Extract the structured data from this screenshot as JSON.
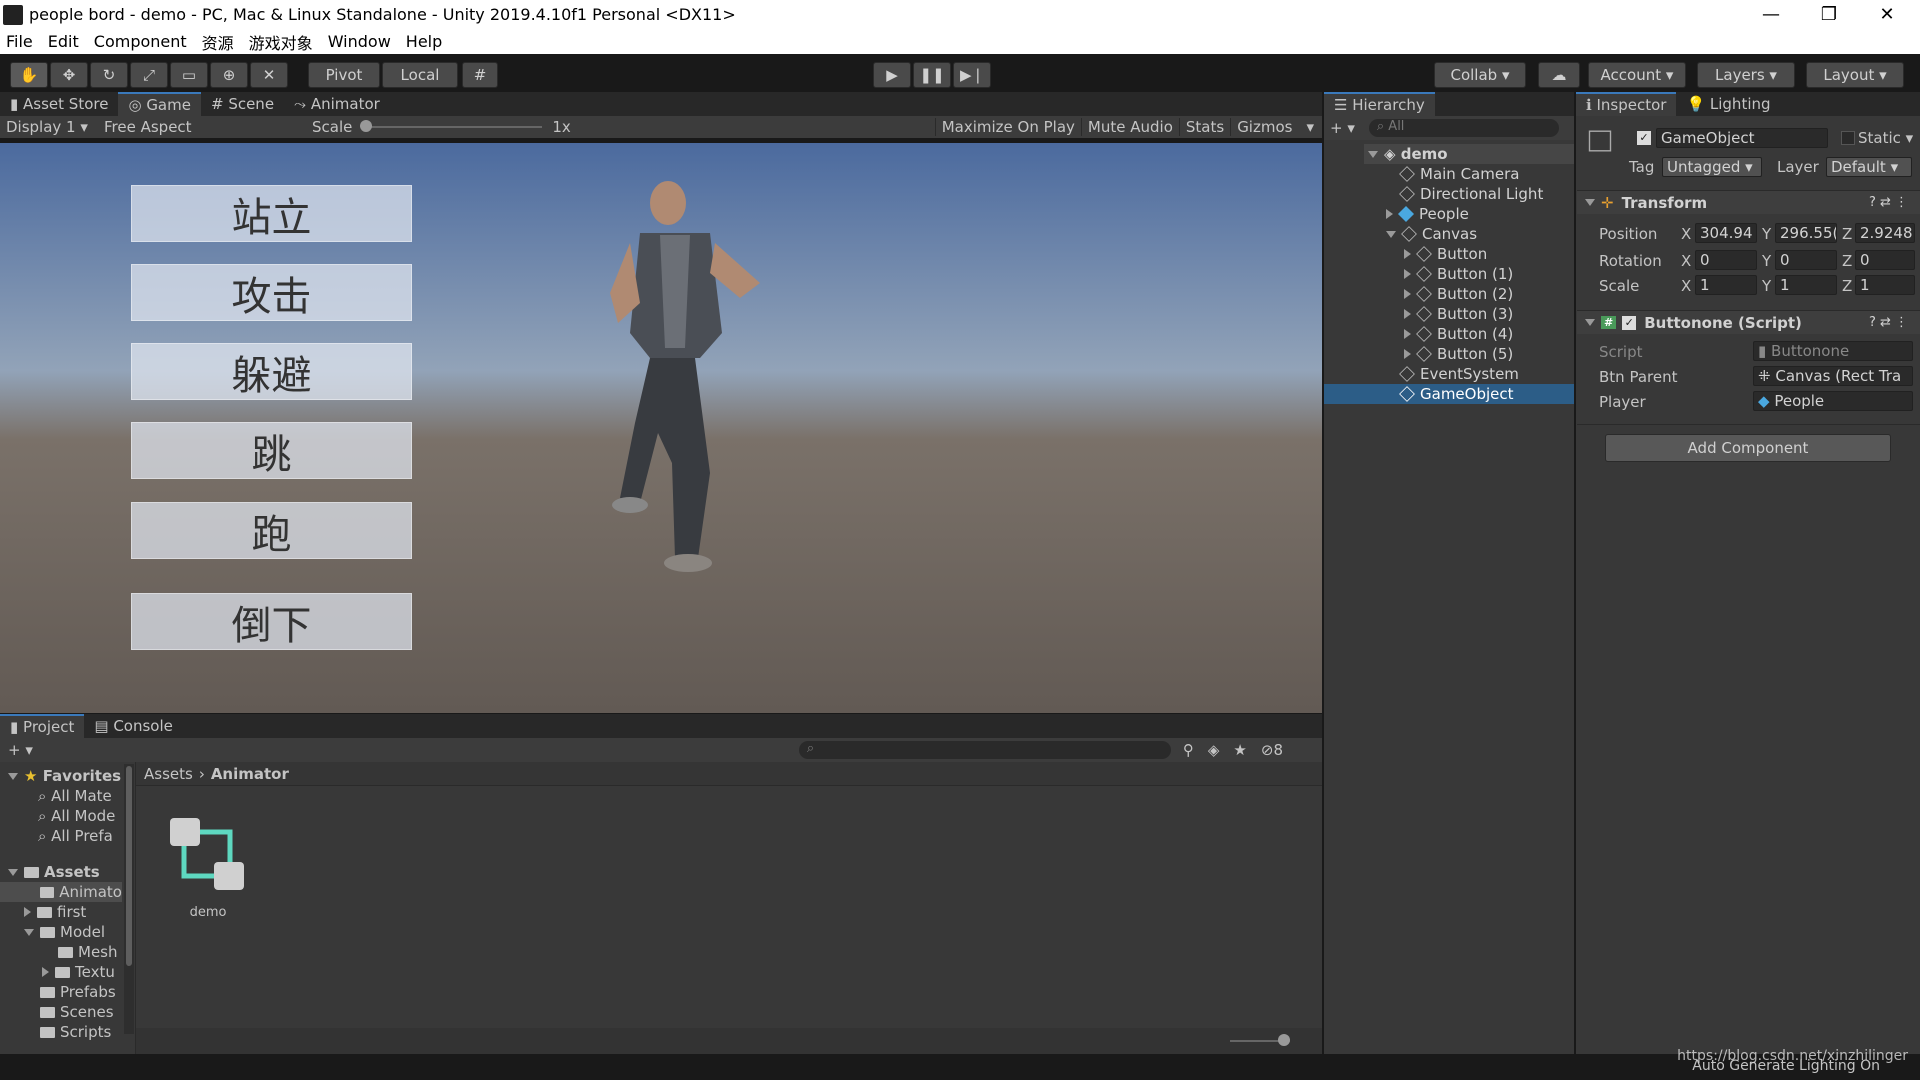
{
  "window": {
    "title": "people bord - demo - PC, Mac & Linux Standalone - Unity 2019.4.10f1 Personal <DX11>",
    "controls": [
      "—",
      "❐",
      "✕"
    ]
  },
  "menu": [
    "File",
    "Edit",
    "Component",
    "资源",
    "游戏对象",
    "Window",
    "Help"
  ],
  "toolbar": {
    "pivot": "Pivot",
    "local": "Local",
    "collab": "Collab",
    "account": "Account",
    "layers": "Layers",
    "layout": "Layout"
  },
  "scene_tabs": [
    "Asset Store",
    "Game",
    "Scene",
    "Animator"
  ],
  "game_toolbar": {
    "display": "Display 1",
    "aspect": "Free Aspect",
    "scale_label": "Scale",
    "scale_value": "1x",
    "maximize": "Maximize On Play",
    "mute": "Mute Audio",
    "stats": "Stats",
    "gizmos": "Gizmos"
  },
  "game_buttons": [
    "站立",
    "攻击",
    "躲避",
    "跳",
    "跑",
    "倒下"
  ],
  "hierarchy": {
    "tab": "Hierarchy",
    "search": "All",
    "scene": "demo",
    "items": [
      "Main Camera",
      "Directional Light",
      "People",
      "Canvas",
      "Button",
      "Button (1)",
      "Button (2)",
      "Button (3)",
      "Button (4)",
      "Button (5)",
      "EventSystem",
      "GameObject"
    ]
  },
  "inspector": {
    "tab": "Inspector",
    "lighting_tab": "Lighting",
    "object_name": "GameObject",
    "static": "Static",
    "tag_label": "Tag",
    "tag": "Untagged",
    "layer_label": "Layer",
    "layer": "Default",
    "transform": {
      "header": "Transform",
      "position_label": "Position",
      "position": [
        "304.94",
        "296.55(",
        "2.9248"
      ],
      "rotation_label": "Rotation",
      "rotation": [
        "0",
        "0",
        "0"
      ],
      "scale_label": "Scale",
      "scale": [
        "1",
        "1",
        "1"
      ],
      "axes": [
        "X",
        "Y",
        "Z"
      ]
    },
    "script": {
      "header": "Buttonone (Script)",
      "script_label": "Script",
      "script_value": "Buttonone",
      "btnparent_label": "Btn Parent",
      "btnparent_value": "Canvas (Rect Tra",
      "player_label": "Player",
      "player_value": "People"
    },
    "add_component": "Add Component"
  },
  "project": {
    "tabs": [
      "Project",
      "Console"
    ],
    "hidden_count": "8",
    "favorites_label": "Favorites",
    "favorites": [
      "All Mate",
      "All Mode",
      "All Prefa"
    ],
    "assets_label": "Assets",
    "tree": [
      "Animato",
      "first",
      "Model",
      "Mesh",
      "Textu",
      "Prefabs",
      "Scenes",
      "Scripts"
    ],
    "breadcrumb": [
      "Assets",
      "Animator"
    ],
    "asset_name": "demo"
  },
  "status": {
    "text": "Auto Generate Lighting On",
    "watermark": "https://blog.csdn.net/xinzhilinger"
  }
}
